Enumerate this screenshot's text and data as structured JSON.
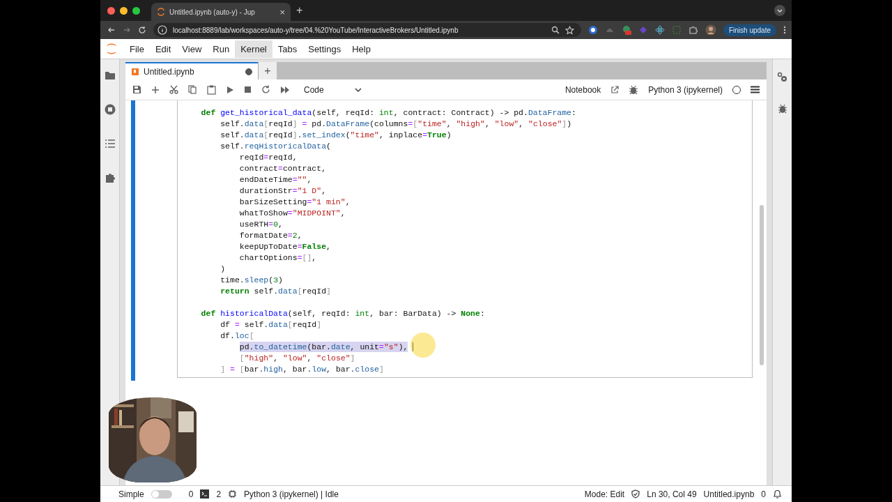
{
  "browser": {
    "tab": {
      "title": "Untitled.ipynb (auto-y) - Jup",
      "close": "×"
    },
    "new_tab": "+",
    "url": "localhost:8889/lab/workspaces/auto-y/tree/04.%20YouTube/InteractiveBrokers/Untitled.ipynb",
    "update_button": "Finish update"
  },
  "menu": [
    {
      "label": "File",
      "selected": false
    },
    {
      "label": "Edit",
      "selected": false
    },
    {
      "label": "View",
      "selected": false
    },
    {
      "label": "Run",
      "selected": false
    },
    {
      "label": "Kernel",
      "selected": true
    },
    {
      "label": "Tabs",
      "selected": false
    },
    {
      "label": "Settings",
      "selected": false
    },
    {
      "label": "Help",
      "selected": false
    }
  ],
  "doc_tab": {
    "title": "Untitled.ipynb",
    "modified": true,
    "add": "+"
  },
  "toolbar": {
    "cell_type": "Code",
    "notebook": "Notebook",
    "kernel": "Python 3 (ipykernel)",
    "kernel_busy": false
  },
  "cell": {
    "active": true,
    "blocks": [
      {
        "selected": false,
        "tokens": [
          {
            "kw": "def "
          },
          {
            "fn": "get_historical_data"
          },
          {
            "p": "(self, reqId: "
          },
          {
            "bi": "int"
          },
          {
            "p": ", contract: Contract) -> pd."
          },
          {
            "attr": "DataFrame"
          },
          {
            "p": ":"
          }
        ],
        "children": [
          {
            "selected": false,
            "tokens": [
              {
                "p": "self."
              },
              {
                "attr": "data"
              },
              {
                "brk": "["
              },
              {
                "p": "reqId"
              },
              {
                "brk": "] "
              },
              {
                "op": "="
              },
              {
                "p": " pd."
              },
              {
                "attr": "DataFrame"
              },
              {
                "p": "(columns"
              },
              {
                "op": "="
              },
              {
                "brk": "["
              },
              {
                "str": "\"time\""
              },
              {
                "p": ", "
              },
              {
                "str": "\"high\""
              },
              {
                "p": ", "
              },
              {
                "str": "\"low\""
              },
              {
                "p": ", "
              },
              {
                "str": "\"close\""
              },
              {
                "brk": "]"
              },
              {
                "p": ")"
              }
            ]
          },
          {
            "selected": false,
            "tokens": [
              {
                "p": "self."
              },
              {
                "attr": "data"
              },
              {
                "brk": "["
              },
              {
                "p": "reqId"
              },
              {
                "brk": "]"
              },
              {
                "p": "."
              },
              {
                "attr": "set_index"
              },
              {
                "p": "("
              },
              {
                "str": "\"time\""
              },
              {
                "p": ", inplace"
              },
              {
                "op": "="
              },
              {
                "kw": "True"
              },
              {
                "p": ")"
              }
            ]
          },
          {
            "selected": false,
            "tokens": [
              {
                "p": "self."
              },
              {
                "attr": "reqHistoricalData"
              },
              {
                "p": "("
              }
            ],
            "children": [
              {
                "selected": false,
                "tokens": [
                  {
                    "p": "reqId"
                  },
                  {
                    "op": "="
                  },
                  {
                    "p": "reqId,"
                  }
                ]
              },
              {
                "selected": false,
                "tokens": [
                  {
                    "p": "contract"
                  },
                  {
                    "op": "="
                  },
                  {
                    "p": "contract,"
                  }
                ]
              },
              {
                "selected": false,
                "tokens": [
                  {
                    "p": "endDateTime"
                  },
                  {
                    "op": "="
                  },
                  {
                    "str": "\"\""
                  },
                  {
                    "p": ","
                  }
                ]
              },
              {
                "selected": false,
                "tokens": [
                  {
                    "p": "durationStr"
                  },
                  {
                    "op": "="
                  },
                  {
                    "str": "\"1 D\""
                  },
                  {
                    "p": ","
                  }
                ]
              },
              {
                "selected": false,
                "tokens": [
                  {
                    "p": "barSizeSetting"
                  },
                  {
                    "op": "="
                  },
                  {
                    "str": "\"1 min\""
                  },
                  {
                    "p": ","
                  }
                ]
              },
              {
                "selected": false,
                "tokens": [
                  {
                    "p": "whatToShow"
                  },
                  {
                    "op": "="
                  },
                  {
                    "str": "\"MIDPOINT\""
                  },
                  {
                    "p": ","
                  }
                ]
              },
              {
                "selected": false,
                "tokens": [
                  {
                    "p": "useRTH"
                  },
                  {
                    "op": "="
                  },
                  {
                    "num": "0"
                  },
                  {
                    "p": ","
                  }
                ]
              },
              {
                "selected": false,
                "tokens": [
                  {
                    "p": "formatDate"
                  },
                  {
                    "op": "="
                  },
                  {
                    "num": "2"
                  },
                  {
                    "p": ","
                  }
                ]
              },
              {
                "selected": false,
                "tokens": [
                  {
                    "p": "keepUpToDate"
                  },
                  {
                    "op": "="
                  },
                  {
                    "kw": "False"
                  },
                  {
                    "p": ","
                  }
                ]
              },
              {
                "selected": false,
                "tokens": [
                  {
                    "p": "chartOptions"
                  },
                  {
                    "op": "="
                  },
                  {
                    "brk": "[]"
                  },
                  {
                    "p": ","
                  }
                ]
              }
            ]
          },
          {
            "selected": false,
            "tokens": [
              {
                "p": ")"
              }
            ]
          },
          {
            "selected": false,
            "tokens": [
              {
                "p": "time."
              },
              {
                "attr": "sleep"
              },
              {
                "p": "("
              },
              {
                "num": "3"
              },
              {
                "p": ")"
              }
            ]
          },
          {
            "selected": false,
            "tokens": [
              {
                "kw": "return"
              },
              {
                "p": " self."
              },
              {
                "attr": "data"
              },
              {
                "brk": "["
              },
              {
                "p": "reqId"
              },
              {
                "brk": "]"
              }
            ]
          }
        ]
      },
      {
        "selected": false,
        "tokens": [
          {
            "kw": "def "
          },
          {
            "fn": "historicalData"
          },
          {
            "p": "(self, reqId: "
          },
          {
            "bi": "int"
          },
          {
            "p": ", bar: BarData) -> "
          },
          {
            "kw": "None"
          },
          {
            "p": ":"
          }
        ],
        "children": [
          {
            "selected": false,
            "tokens": [
              {
                "p": "df "
              },
              {
                "op": "="
              },
              {
                "p": " self."
              },
              {
                "attr": "data"
              },
              {
                "brk": "["
              },
              {
                "p": "reqId"
              },
              {
                "brk": "]"
              }
            ]
          },
          {
            "selected": false,
            "tokens": [
              {
                "p": "df."
              },
              {
                "attr": "loc"
              },
              {
                "brk": "["
              }
            ],
            "children": [
              {
                "selected": true,
                "tokens": [
                  {
                    "p": "pd."
                  },
                  {
                    "attr": "to_datetime"
                  },
                  {
                    "p": "(bar."
                  },
                  {
                    "attr": "date"
                  },
                  {
                    "p": ", unit"
                  },
                  {
                    "op": "="
                  },
                  {
                    "str": "\"s\""
                  },
                  {
                    "p": "),"
                  }
                ]
              },
              {
                "selected": false,
                "tokens": [
                  {
                    "brk": "["
                  },
                  {
                    "str": "\"high\""
                  },
                  {
                    "p": ", "
                  },
                  {
                    "str": "\"low\""
                  },
                  {
                    "p": ", "
                  },
                  {
                    "str": "\"close\""
                  },
                  {
                    "brk": "]"
                  }
                ]
              }
            ]
          },
          {
            "selected": false,
            "tokens": [
              {
                "brk": "] "
              },
              {
                "op": "="
              },
              {
                "brk": " ["
              },
              {
                "p": "bar."
              },
              {
                "attr": "high"
              },
              {
                "p": ", bar."
              },
              {
                "attr": "low"
              },
              {
                "p": ", bar."
              },
              {
                "attr": "close"
              },
              {
                "brk": "]"
              }
            ]
          }
        ]
      }
    ]
  },
  "status_bar": {
    "simple_label": "Simple",
    "simple_on": false,
    "terminals": "0",
    "kernels": "2",
    "kernel_status": "Python 3 (ipykernel) | Idle",
    "mode": "Mode: Edit",
    "position": "Ln 30, Col 49",
    "file": "Untitled.ipynb",
    "notifications": "0"
  }
}
